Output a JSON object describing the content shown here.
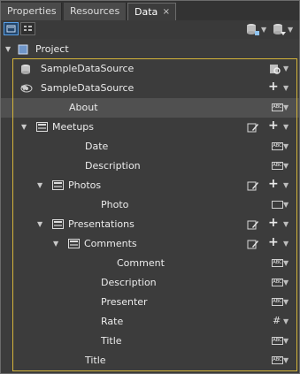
{
  "tabs": [
    {
      "label": "Properties",
      "active": false
    },
    {
      "label": "Resources",
      "active": false
    },
    {
      "label": "Data",
      "active": true,
      "close": "×"
    }
  ],
  "toolbar": {
    "list_view": "list-view-icon",
    "details_view": "details-view-icon",
    "add_project_data": "database-add-icon",
    "add_data_source": "data-source-add-icon"
  },
  "tree": [
    {
      "label": "Project",
      "depth": 0,
      "expander": "expanded",
      "icon": "project-icon",
      "right": []
    },
    {
      "label": "SampleDataSource",
      "depth": 1,
      "expander": "none",
      "icon": "database-icon",
      "right": [
        "options"
      ]
    },
    {
      "label": "SampleDataSource",
      "depth": 1,
      "expander": "expanded",
      "icon": "eye-icon",
      "right": [
        "plus"
      ]
    },
    {
      "label": "About",
      "depth": 2,
      "expander": "none",
      "icon": "",
      "right": [
        "abc"
      ],
      "highlight": true
    },
    {
      "label": "Meetups",
      "depth": 2,
      "expander": "expanded",
      "icon": "collection-icon",
      "right": [
        "edit",
        "plus"
      ]
    },
    {
      "label": "Date",
      "depth": 3,
      "expander": "none",
      "icon": "",
      "right": [
        "abc"
      ]
    },
    {
      "label": "Description",
      "depth": 3,
      "expander": "none",
      "icon": "",
      "right": [
        "abc"
      ]
    },
    {
      "label": "Photos",
      "depth": 3,
      "expander": "expanded",
      "icon": "collection-icon",
      "right": [
        "edit",
        "plus"
      ]
    },
    {
      "label": "Photo",
      "depth": 4,
      "expander": "none",
      "icon": "",
      "right": [
        "image"
      ]
    },
    {
      "label": "Presentations",
      "depth": 3,
      "expander": "expanded",
      "icon": "collection-icon",
      "right": [
        "edit",
        "plus"
      ]
    },
    {
      "label": "Comments",
      "depth": 4,
      "expander": "expanded",
      "icon": "collection-icon",
      "right": [
        "edit",
        "plus"
      ]
    },
    {
      "label": "Comment",
      "depth": 5,
      "expander": "none",
      "icon": "",
      "right": [
        "abc"
      ]
    },
    {
      "label": "Description",
      "depth": 4,
      "expander": "none",
      "icon": "",
      "right": [
        "abc"
      ]
    },
    {
      "label": "Presenter",
      "depth": 4,
      "expander": "none",
      "icon": "",
      "right": [
        "abc"
      ]
    },
    {
      "label": "Rate",
      "depth": 4,
      "expander": "none",
      "icon": "",
      "right": [
        "number"
      ]
    },
    {
      "label": "Title",
      "depth": 4,
      "expander": "none",
      "icon": "",
      "right": [
        "abc"
      ]
    },
    {
      "label": "Title",
      "depth": 3,
      "expander": "none",
      "icon": "",
      "right": [
        "abc"
      ]
    }
  ],
  "type_text": {
    "abc": "ABC",
    "number": "#"
  },
  "colors": {
    "selection_border": "#d4b43a",
    "highlight_row": "#505050",
    "accent": "#5aa0e6"
  }
}
